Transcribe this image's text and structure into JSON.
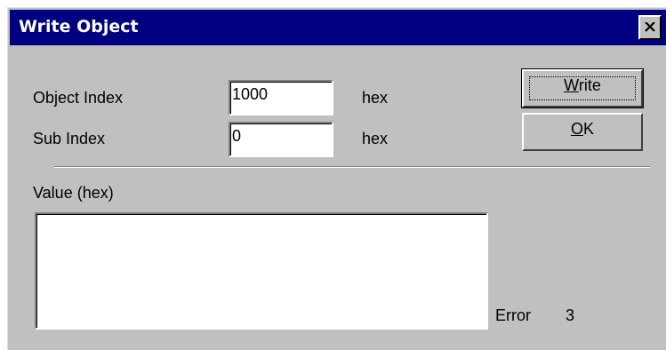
{
  "window": {
    "title": "Write Object"
  },
  "fields": {
    "object_index": {
      "label": "Object Index",
      "value": "1000",
      "unit": "hex"
    },
    "sub_index": {
      "label": "Sub Index",
      "value": "0",
      "unit": "hex"
    }
  },
  "buttons": {
    "write": {
      "mnemonic": "W",
      "rest": "rite"
    },
    "ok": {
      "mnemonic": "O",
      "rest": "K"
    }
  },
  "value": {
    "label": "Value (hex)",
    "text": ""
  },
  "status": {
    "error_label": "Error",
    "error_value": "3"
  },
  "icons": [
    "close-icon"
  ]
}
